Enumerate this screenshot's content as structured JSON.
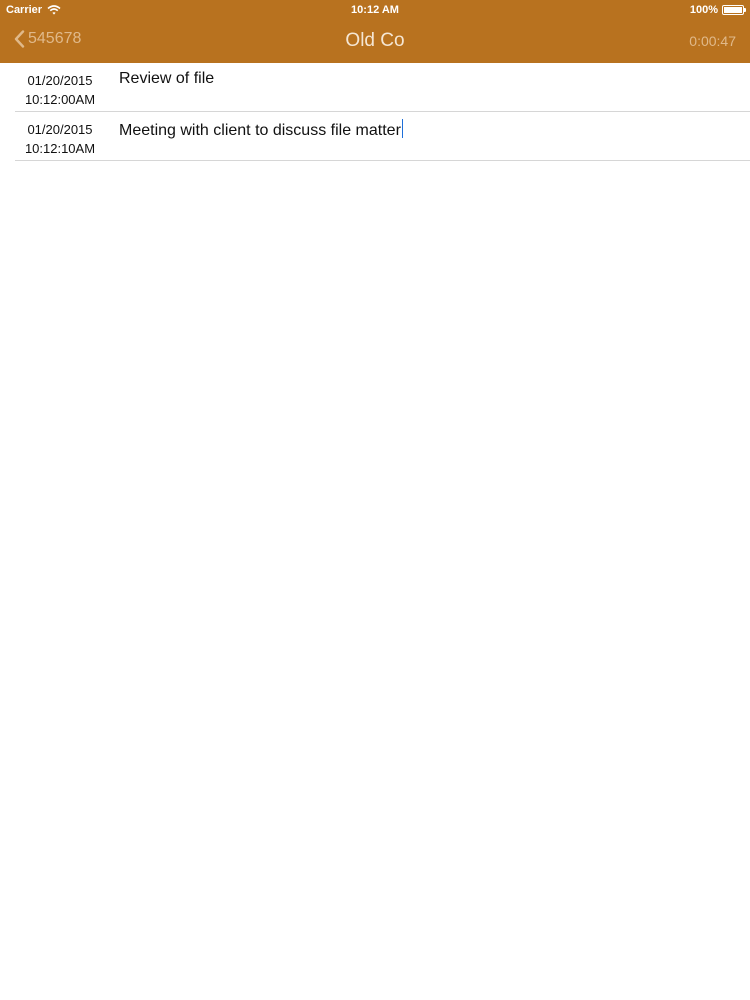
{
  "status_bar": {
    "carrier": "Carrier",
    "time": "10:12 AM",
    "battery": "100%"
  },
  "nav": {
    "back_label": "545678",
    "title": "Old Co",
    "timer": "0:00:47"
  },
  "entries": [
    {
      "date": "01/20/2015",
      "time": "10:12:00AM",
      "description": "Review of file"
    },
    {
      "date": "01/20/2015",
      "time": "10:12:10AM",
      "description": "Meeting with client to discuss file matter"
    }
  ],
  "colors": {
    "header": "#b8721f",
    "nav_text": "#e0b98a",
    "cursor": "#1e6fd9"
  },
  "icons": {
    "back": "chevron-left-icon",
    "wifi": "wifi-icon",
    "battery": "battery-icon"
  }
}
